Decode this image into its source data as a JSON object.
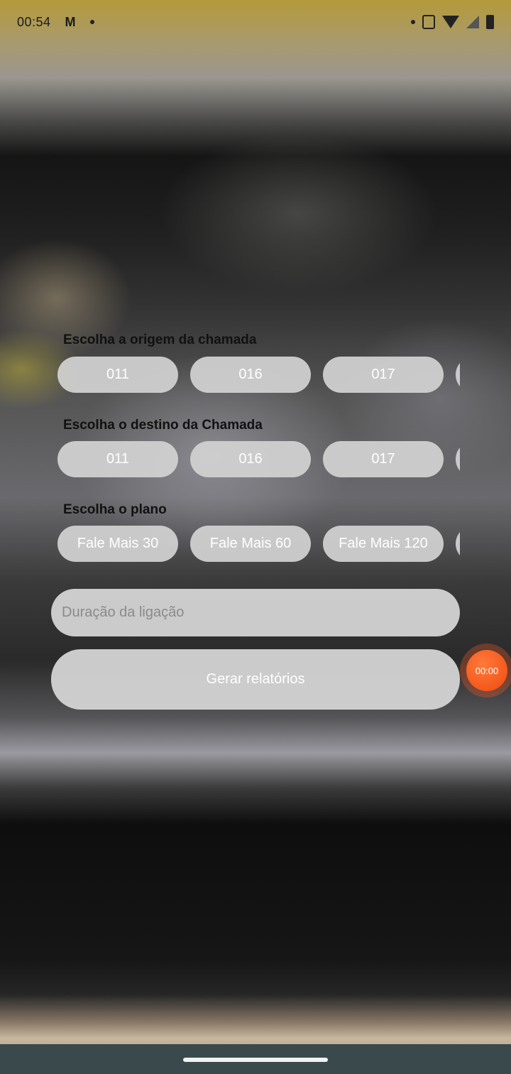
{
  "status_bar": {
    "time": "00:54",
    "mail_icon": "gmail-icon",
    "icons": [
      "notification-dot-icon",
      "vibrate-icon",
      "wifi-icon",
      "signal-icon",
      "battery-icon"
    ]
  },
  "origin": {
    "label": "Escolha a origem da chamada",
    "options": [
      "011",
      "016",
      "017",
      ""
    ]
  },
  "destination": {
    "label": "Escolha o destino da Chamada",
    "options": [
      "011",
      "016",
      "017",
      ""
    ]
  },
  "plan": {
    "label": "Escolha o plano",
    "options": [
      "Fale Mais 30",
      "Fale Mais 60",
      "Fale Mais 120",
      ""
    ]
  },
  "duration": {
    "placeholder": "Duração da ligação"
  },
  "generate_button": {
    "label": "Gerar relatórios"
  },
  "recorder": {
    "time": "00:00",
    "color": "#f04a10"
  }
}
